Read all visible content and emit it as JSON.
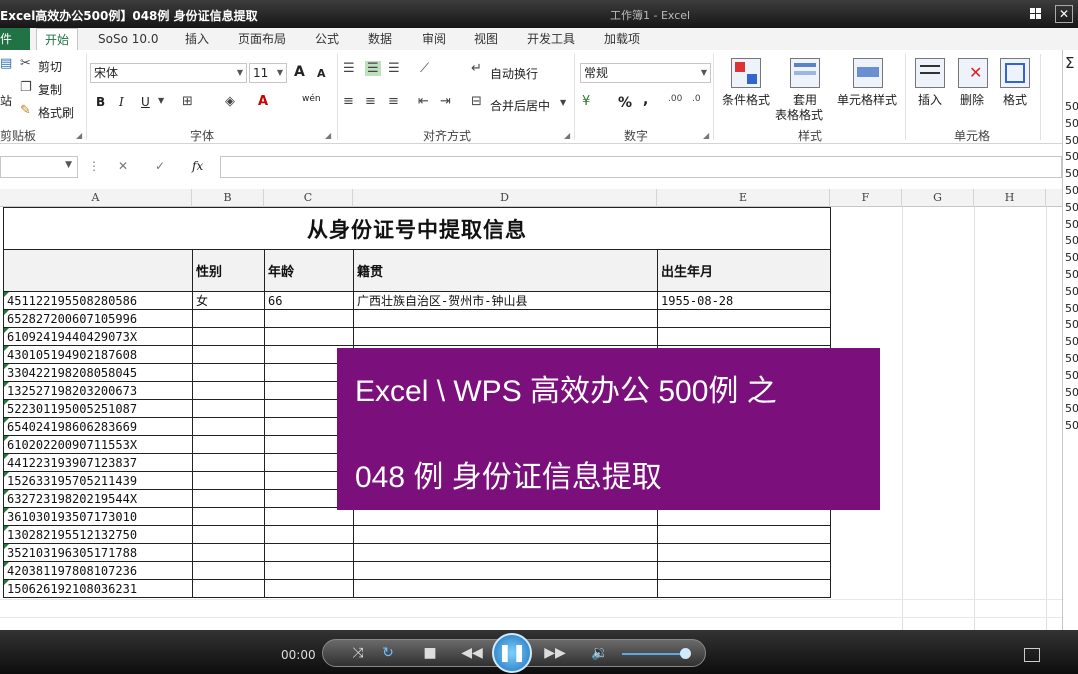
{
  "titlebar": {
    "title": "Excel高效办公500例】048例 身份证信息提取",
    "ghost_title": "工作簿1 - Excel"
  },
  "tabs": [
    "件",
    "开始",
    "SoSo 10.0",
    "插入",
    "页面布局",
    "公式",
    "数据",
    "审阅",
    "视图",
    "开发工具",
    "加载项"
  ],
  "ribbon": {
    "clipboard": {
      "cut": "剪切",
      "copy": "复制",
      "format_painter": "格式刷",
      "paste_partial": "站",
      "label": "剪贴板"
    },
    "font": {
      "name": "宋体",
      "size": "11",
      "bold": "B",
      "italic": "I",
      "underline": "U",
      "label": "字体",
      "grow": "A",
      "shrink": "A",
      "wen": "wén"
    },
    "alignment": {
      "wrap": "自动换行",
      "merge": "合并后居中",
      "label": "对齐方式"
    },
    "number": {
      "format": "常规",
      "percent": "%",
      "comma": ",",
      "label": "数字"
    },
    "styles": {
      "conditional": "条件格式",
      "table_fmt_1": "套用",
      "table_fmt_2": "表格格式",
      "cell_styles": "单元格样式",
      "label": "样式"
    },
    "cells": {
      "insert": "插入",
      "delete": "删除",
      "format": "格式",
      "label": "单元格"
    }
  },
  "formula_bar": {
    "fx": "fx",
    "cancel": "✕",
    "confirm": "✓",
    "more": "⋮"
  },
  "columns": [
    "A",
    "B",
    "C",
    "D",
    "E",
    "F",
    "G",
    "H"
  ],
  "sheet": {
    "title": "从身份证号中提取信息",
    "headers": [
      "",
      "性别",
      "年龄",
      "籍贯",
      "出生年月"
    ],
    "rows": [
      [
        "451122195508280586",
        "女",
        "66",
        "广西壮族自治区-贺州市-钟山县",
        "1955-08-28"
      ],
      [
        "652827200607105996",
        "",
        "",
        "",
        ""
      ],
      [
        "61092419440429073X",
        "",
        "",
        "",
        ""
      ],
      [
        "430105194902187608",
        "",
        "",
        "",
        ""
      ],
      [
        "330422198208058045",
        "",
        "",
        "",
        ""
      ],
      [
        "132527198203200673",
        "",
        "",
        "",
        ""
      ],
      [
        "522301195005251087",
        "",
        "",
        "",
        ""
      ],
      [
        "654024198606283669",
        "",
        "",
        "",
        ""
      ],
      [
        "61020220090711553X",
        "",
        "",
        "",
        ""
      ],
      [
        "441223193907123837",
        "",
        "",
        "",
        ""
      ],
      [
        "152633195705211439",
        "",
        "",
        "",
        ""
      ],
      [
        "63272319820219544X",
        "",
        "",
        "",
        ""
      ],
      [
        "361030193507173010",
        "",
        "",
        "",
        ""
      ],
      [
        "130282195512132750",
        "",
        "",
        "",
        ""
      ],
      [
        "352103196305171788",
        "",
        "",
        "",
        ""
      ],
      [
        "420381197808107236",
        "",
        "",
        "",
        ""
      ],
      [
        "150626192108036231",
        "",
        "",
        "",
        ""
      ]
    ]
  },
  "overlay": {
    "line1": "Excel \\ WPS 高效办公 500例 之",
    "line2": "048 例  身份证信息提取",
    "color": "#7b0f7b"
  },
  "right_strip": [
    "Σ",
    "50",
    "50",
    "50",
    "50",
    "50",
    "50",
    "50",
    "50",
    "50",
    "50",
    "50",
    "50",
    "50",
    "50",
    "50",
    "50",
    "50",
    "50",
    "50",
    "50"
  ],
  "player": {
    "time": "00:00"
  }
}
